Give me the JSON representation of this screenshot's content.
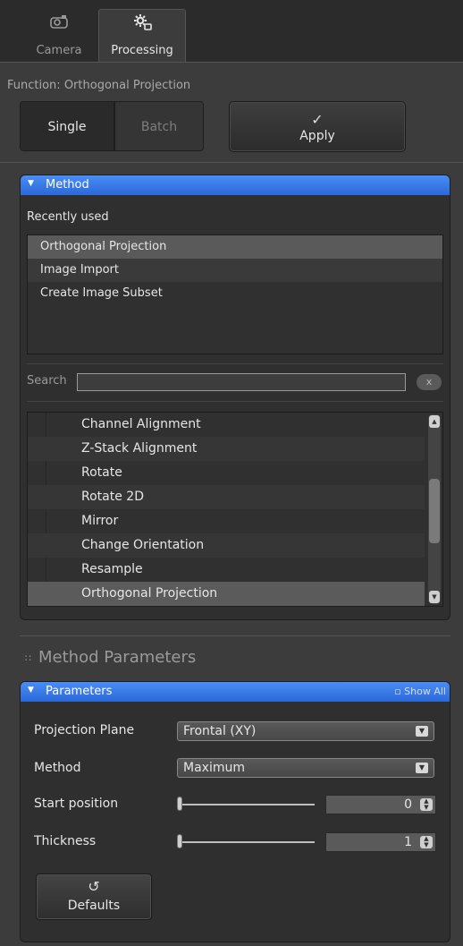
{
  "tabs": [
    {
      "label": "Camera",
      "icon": "camera-icon",
      "active": false
    },
    {
      "label": "Processing",
      "icon": "gear-icon",
      "active": true
    }
  ],
  "function": {
    "label": "Function:",
    "value": "Orthogonal Projection",
    "mode_single": "Single",
    "mode_batch": "Batch",
    "apply_label": "Apply",
    "apply_icon": "checkmark-icon"
  },
  "method_panel": {
    "title": "Method",
    "recent_label": "Recently used",
    "recent_items": [
      "Orthogonal Projection",
      "Image Import",
      "Create Image Subset"
    ],
    "search_label": "Search",
    "search_value": "",
    "search_clear": "x",
    "list_items": [
      "Channel Alignment",
      "Z-Stack Alignment",
      "Rotate",
      "Rotate 2D",
      "Mirror",
      "Change Orientation",
      "Resample",
      "Orthogonal Projection"
    ],
    "selected_item": "Orthogonal Projection"
  },
  "method_parameters": {
    "title": "Method Parameters",
    "panel_title": "Parameters",
    "show_all": "Show All",
    "projection_plane": {
      "label": "Projection Plane",
      "value": "Frontal (XY)"
    },
    "method": {
      "label": "Method",
      "value": "Maximum"
    },
    "start_position": {
      "label": "Start position",
      "value": "0",
      "slider_fraction": 0
    },
    "thickness": {
      "label": "Thickness",
      "value": "1",
      "slider_fraction": 0
    },
    "defaults_label": "Defaults"
  },
  "colors": {
    "accent": "#2b68d8",
    "background": "#3c3c3c",
    "panel": "#2f2f2f"
  }
}
